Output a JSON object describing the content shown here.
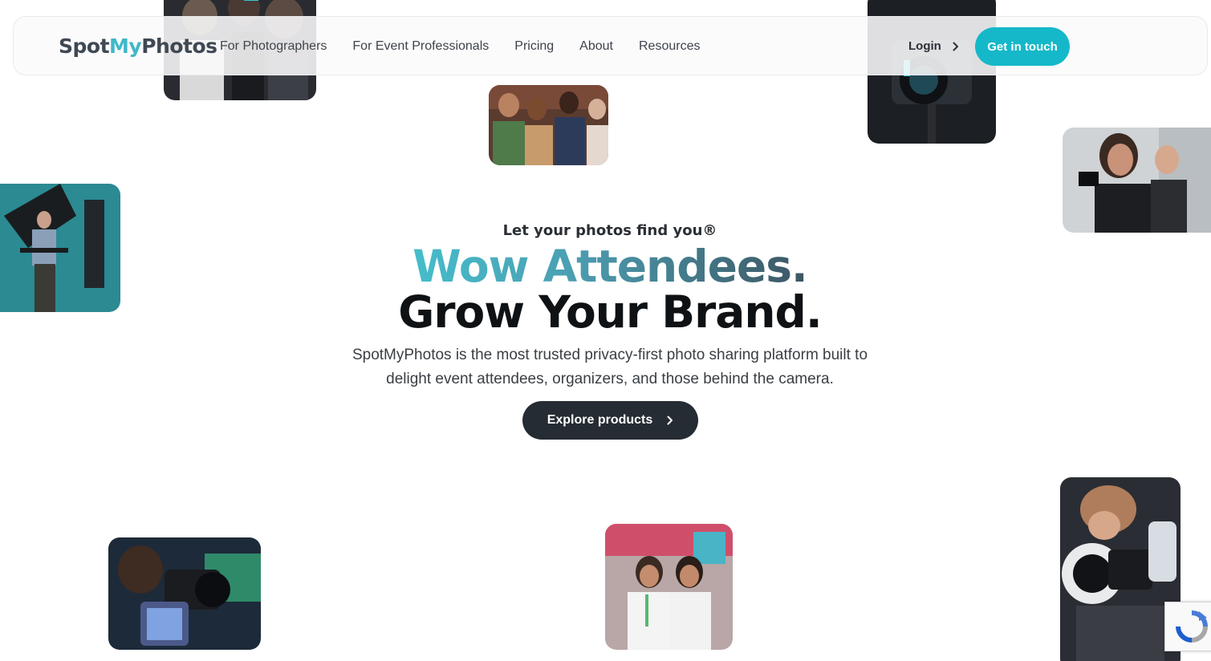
{
  "header": {
    "logo": {
      "part1": "Spot",
      "part2": "My",
      "part3": "Photos"
    },
    "nav": [
      {
        "label": "For Photographers"
      },
      {
        "label": "For Event Professionals"
      },
      {
        "label": "Pricing"
      },
      {
        "label": "About"
      },
      {
        "label": "Resources"
      }
    ],
    "login_label": "Login",
    "cta_label": "Get in touch"
  },
  "hero": {
    "eyebrow": "Let your photos find you®",
    "headline_line1": "Wow Attendees.",
    "headline_line2": "Grow Your Brand.",
    "subtext": "SpotMyPhotos is the most trusted privacy-first photo sharing platform built to delight event attendees, organizers, and those behind the camera.",
    "button_label": "Explore products"
  },
  "colors": {
    "brand_teal": "#15b8c9",
    "dark_button": "#262c33",
    "text_dark": "#0f1215"
  },
  "icons": [
    "chevron-right-icon",
    "recaptcha-icon"
  ]
}
